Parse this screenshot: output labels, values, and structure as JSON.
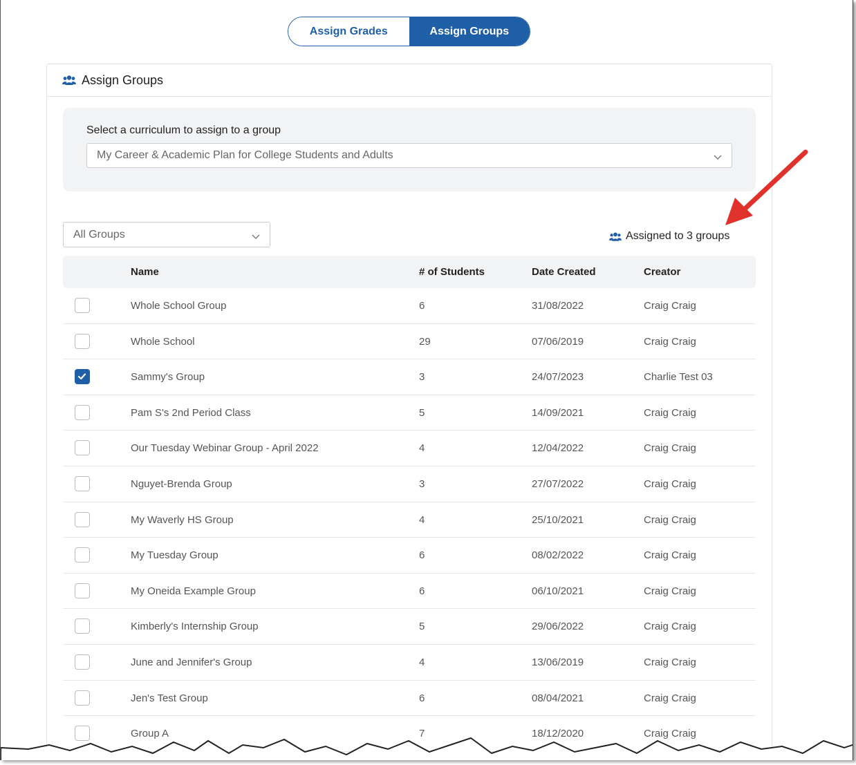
{
  "toggle": {
    "grades_label": "Assign Grades",
    "groups_label": "Assign Groups"
  },
  "card": {
    "title": "Assign Groups",
    "title_icon": "users-icon"
  },
  "curriculum": {
    "label": "Select a curriculum to assign to a group",
    "selected": "My Career & Academic Plan for College Students and Adults"
  },
  "filter": {
    "selected": "All Groups"
  },
  "assigned": {
    "text": "Assigned to 3 groups",
    "icon": "users-icon"
  },
  "table": {
    "columns": {
      "name": "Name",
      "students": "# of Students",
      "date": "Date Created",
      "creator": "Creator"
    },
    "rows": [
      {
        "name": "Whole School Group",
        "students": "6",
        "date": "31/08/2022",
        "creator": "Craig Craig",
        "checked": false
      },
      {
        "name": "Whole School",
        "students": "29",
        "date": "07/06/2019",
        "creator": "Craig Craig",
        "checked": false
      },
      {
        "name": "Sammy's Group",
        "students": "3",
        "date": "24/07/2023",
        "creator": "Charlie Test 03",
        "checked": true
      },
      {
        "name": "Pam S's 2nd Period Class",
        "students": "5",
        "date": "14/09/2021",
        "creator": "Craig Craig",
        "checked": false
      },
      {
        "name": "Our Tuesday Webinar Group - April 2022",
        "students": "4",
        "date": "12/04/2022",
        "creator": "Craig Craig",
        "checked": false
      },
      {
        "name": "Nguyet-Brenda Group",
        "students": "3",
        "date": "27/07/2022",
        "creator": "Craig Craig",
        "checked": false
      },
      {
        "name": "My Waverly HS Group",
        "students": "4",
        "date": "25/10/2021",
        "creator": "Craig Craig",
        "checked": false
      },
      {
        "name": "My Tuesday Group",
        "students": "6",
        "date": "08/02/2022",
        "creator": "Craig Craig",
        "checked": false
      },
      {
        "name": "My Oneida Example Group",
        "students": "6",
        "date": "06/10/2021",
        "creator": "Craig Craig",
        "checked": false
      },
      {
        "name": "Kimberly's Internship Group",
        "students": "5",
        "date": "29/06/2022",
        "creator": "Craig Craig",
        "checked": false
      },
      {
        "name": "June and Jennifer's Group",
        "students": "4",
        "date": "13/06/2019",
        "creator": "Craig Craig",
        "checked": false
      },
      {
        "name": "Jen's Test Group",
        "students": "6",
        "date": "08/04/2021",
        "creator": "Craig Craig",
        "checked": false
      },
      {
        "name": "Group A",
        "students": "7",
        "date": "18/12/2020",
        "creator": "Craig Craig",
        "checked": false
      }
    ]
  },
  "colors": {
    "primary": "#1f5fa8",
    "annotation_arrow": "#e0322b"
  }
}
